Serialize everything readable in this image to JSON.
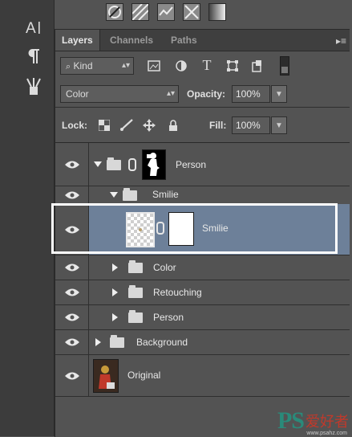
{
  "tabs": [
    {
      "label": "Layers",
      "active": true
    },
    {
      "label": "Channels",
      "active": false
    },
    {
      "label": "Paths",
      "active": false
    }
  ],
  "filter": {
    "kind_label": "Kind"
  },
  "blend": {
    "mode": "Color",
    "opacity_label": "Opacity:",
    "opacity_value": "100%"
  },
  "lock": {
    "label": "Lock:",
    "fill_label": "Fill:",
    "fill_value": "100%"
  },
  "layers": [
    {
      "name": "Person",
      "type": "group-with-mask",
      "expanded": true
    },
    {
      "name": "Smilie",
      "type": "group",
      "expanded": true
    },
    {
      "name": "Smilie",
      "type": "layer-with-mask",
      "selected": true
    },
    {
      "name": "Color",
      "type": "group",
      "expanded": false
    },
    {
      "name": "Retouching",
      "type": "group",
      "expanded": false
    },
    {
      "name": "Person",
      "type": "group",
      "expanded": false
    },
    {
      "name": "Background",
      "type": "group",
      "expanded": false
    },
    {
      "name": "Original",
      "type": "image-layer"
    }
  ],
  "watermark": {
    "ps": "PS",
    "cn": "爱好者",
    "url": "www.psahz.com"
  },
  "colors": {
    "panel_bg": "#535353",
    "selected_row": "#6d8099",
    "highlight_border": "#ffffff"
  }
}
